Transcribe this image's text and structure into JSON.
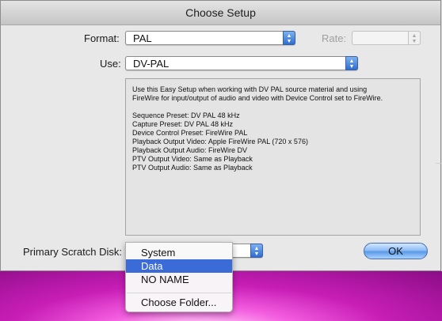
{
  "window": {
    "title": "Choose Setup"
  },
  "format": {
    "label": "Format:",
    "value": "PAL"
  },
  "rate": {
    "label": "Rate:",
    "value": ""
  },
  "use": {
    "label": "Use:",
    "value": "DV-PAL"
  },
  "description": {
    "intro_line1": "Use this Easy Setup when working with DV PAL source material and using",
    "intro_line2": "FireWire for input/output of audio and video with Device Control set to FireWire.",
    "lines": [
      "Sequence Preset: DV PAL 48 kHz",
      "Capture Preset: DV PAL 48 kHz",
      "Device Control Preset: FireWire PAL",
      "Playback Output Video: Apple FireWire PAL (720 x 576)",
      "Playback Output Audio: FireWire DV",
      "PTV Output Video: Same as Playback",
      "PTV Output Audio: Same as Playback"
    ]
  },
  "scratch_disk": {
    "label": "Primary Scratch Disk:",
    "menu": {
      "items": [
        "System",
        "Data",
        "NO NAME"
      ],
      "selected": "Data",
      "choose_folder": "Choose Folder..."
    }
  },
  "ok_button": {
    "label": "OK"
  },
  "colors": {
    "menu_highlight": "#3b6bd6",
    "popup_arrow": "#2e6ed2",
    "desktop_pink": "#e040cf"
  }
}
